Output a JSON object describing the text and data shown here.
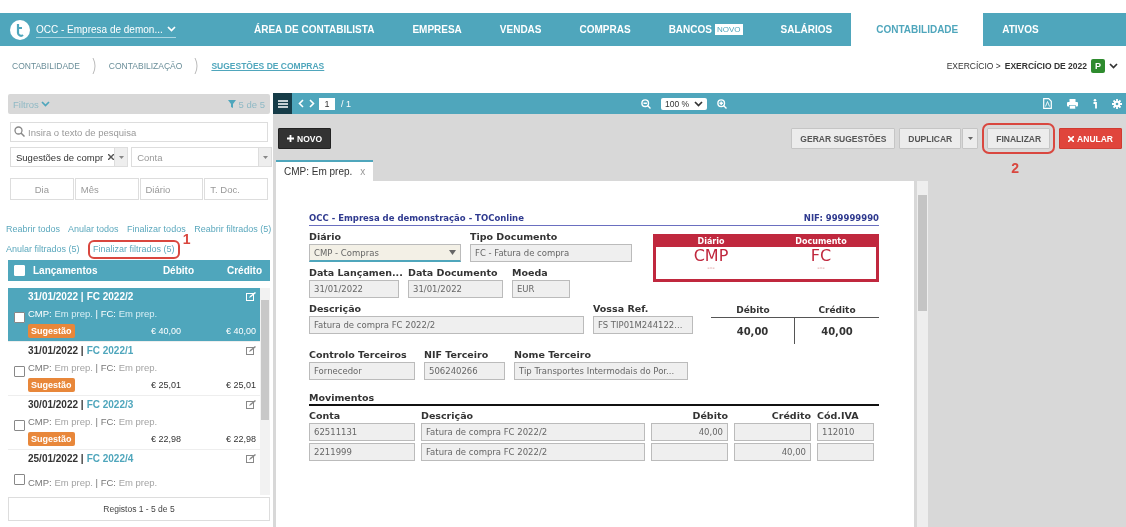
{
  "nav": {
    "company": "OCC - Empresa de demon...",
    "items": [
      {
        "label": "ÁREA DE CONTABILISTA",
        "selected": false
      },
      {
        "label": "EMPRESA",
        "selected": false
      },
      {
        "label": "VENDAS",
        "selected": false
      },
      {
        "label": "COMPRAS",
        "selected": false
      },
      {
        "label": "BANCOS",
        "badge": "NOVO",
        "selected": false
      },
      {
        "label": "SALÁRIOS",
        "selected": false
      },
      {
        "label": "CONTABILIDADE",
        "selected": true
      },
      {
        "label": "ATIVOS",
        "selected": false
      }
    ]
  },
  "breadcrumb": [
    {
      "label": "CONTABILIDADE",
      "current": false
    },
    {
      "label": "CONTABILIZAÇÃO",
      "current": false
    },
    {
      "label": "SUGESTÕES DE COMPRAS",
      "current": true
    }
  ],
  "exercise": {
    "label": "EXERCÍCIO >",
    "value": "EXERCÍCIO DE 2022",
    "badge": "P"
  },
  "sidebar": {
    "filters_label": "Filtros",
    "filter_count": "5 de 5",
    "search": {
      "placeholder": "Insira o texto de pesquisa"
    },
    "type_select": {
      "value": "Sugestões de compr"
    },
    "account_select": {
      "placeholder": "Conta"
    },
    "date_fields": [
      {
        "placeholder": "Dia"
      },
      {
        "placeholder": "Mês"
      },
      {
        "placeholder": "Diário"
      },
      {
        "placeholder": "T. Doc."
      }
    ],
    "actions": [
      {
        "label": "Reabrir todos"
      },
      {
        "label": "Anular todos"
      },
      {
        "label": "Finalizar todos"
      },
      {
        "label": "Reabrir filtrados (5)"
      },
      {
        "label": "Anular filtrados (5)"
      },
      {
        "label": "Finalizar filtrados (5)",
        "callout": "1"
      }
    ],
    "table": {
      "all_checked": false,
      "columns": [
        "Lançamentos",
        "Débito",
        "Crédito"
      ],
      "rows": [
        {
          "date": "31/01/2022 |",
          "document": "FC 2022/2",
          "status": [
            "CMP:",
            "Em prep.",
            "| FC:",
            "Em prep."
          ],
          "badge": "Sugestão",
          "debit": "€ 40,00",
          "credit": "€ 40,00",
          "checked": false,
          "selected": true
        },
        {
          "date": "31/01/2022 |",
          "document": "FC 2022/1",
          "status": [
            "CMP:",
            "Em prep.",
            "| FC:",
            "Em prep."
          ],
          "badge": "Sugestão",
          "debit": "€ 25,01",
          "credit": "€ 25,01",
          "checked": false,
          "selected": false
        },
        {
          "date": "30/01/2022 |",
          "document": "FC 2022/3",
          "status": [
            "CMP:",
            "Em prep.",
            "| FC:",
            "Em prep."
          ],
          "badge": "Sugestão",
          "debit": "€ 22,98",
          "credit": "€ 22,98",
          "checked": false,
          "selected": false
        },
        {
          "date": "25/01/2022 |",
          "document": "FC 2022/4",
          "status": [
            "CMP:",
            "Em prep.",
            "| FC:",
            "Em prep."
          ],
          "checked": false,
          "selected": false
        }
      ]
    },
    "footer": "Registos 1 - 5 de 5"
  },
  "viewer": {
    "page": "1",
    "pages": "/ 1",
    "zoom": "100 %"
  },
  "buttons": [
    {
      "label": "NOVO",
      "kind": "new"
    },
    {
      "label": "GERAR SUGESTÕES",
      "kind": "plain"
    },
    {
      "label": "DUPLICAR",
      "kind": "split"
    },
    {
      "label": "FINALIZAR",
      "kind": "plain",
      "callout": "2"
    },
    {
      "label": "ANULAR",
      "kind": "danger"
    }
  ],
  "doc_tab": {
    "label": "CMP: Em prep.",
    "close": "x"
  },
  "document": {
    "company": "OCC - Empresa de demonstração - TOConline",
    "nif": "NIF: 999999990",
    "field_rows": [
      [
        {
          "label": "Diário",
          "value": "CMP - Compras",
          "kind": "select"
        },
        {
          "label": "Tipo Documento",
          "value": "FC - Fatura de compra",
          "kind": "text"
        }
      ],
      [
        {
          "label": "Data Lançamen...",
          "value": "31/01/2022",
          "kind": "text"
        },
        {
          "label": "Data Documento",
          "value": "31/01/2022",
          "kind": "text"
        },
        {
          "label": "Moeda",
          "value": "EUR",
          "kind": "text"
        }
      ],
      [
        {
          "label": "Descrição",
          "value": "Fatura de compra FC 2022/2",
          "kind": "text"
        },
        {
          "label": "Vossa Ref.",
          "value": "FS TIP01M244122...",
          "kind": "text"
        }
      ],
      [
        {
          "label": "Controlo Terceiros",
          "value": "Fornecedor",
          "kind": "text"
        },
        {
          "label": "NIF Terceiro",
          "value": "506240266",
          "kind": "text"
        },
        {
          "label": "Nome Terceiro",
          "value": "Tip Transportes Intermodais do Por...",
          "kind": "text"
        }
      ]
    ],
    "stamp": [
      {
        "label": "Diário",
        "code": "CMP",
        "number": "---"
      },
      {
        "label": "Documento",
        "code": "FC",
        "number": "---"
      }
    ],
    "totals": {
      "columns": [
        "Débito",
        "Crédito"
      ],
      "values": [
        "40,00",
        "40,00"
      ]
    },
    "movements": {
      "title": "Movimentos",
      "columns": [
        "Conta",
        "Descrição",
        "Débito",
        "Crédito",
        "Cód.IVA"
      ],
      "rows": [
        [
          "62511131",
          "Fatura de compra FC 2022/2",
          "40,00",
          "",
          "112010"
        ],
        [
          "2211999",
          "Fatura de compra FC 2022/2",
          "",
          "40,00",
          ""
        ]
      ]
    }
  }
}
